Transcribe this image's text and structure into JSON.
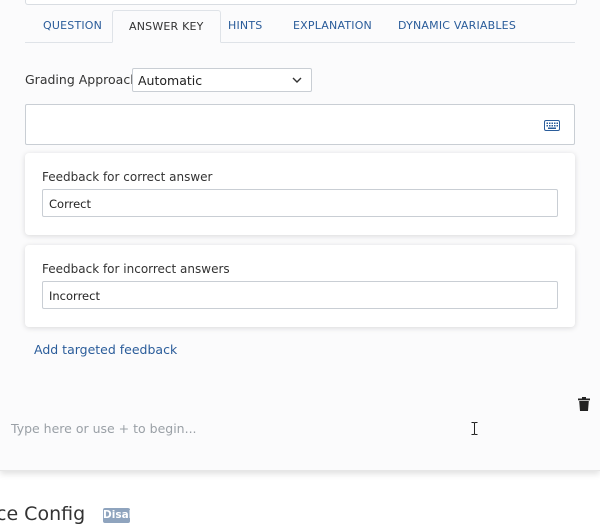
{
  "tabs": [
    {
      "label": "QUESTION"
    },
    {
      "label": "ANSWER KEY",
      "active": true
    },
    {
      "label": "HINTS"
    },
    {
      "label": "EXPLANATION"
    },
    {
      "label": "DYNAMIC VARIABLES"
    }
  ],
  "grading": {
    "label": "Grading Approach",
    "selected": "Automatic"
  },
  "answer_input": {
    "icon": "keyboard-icon"
  },
  "feedback_correct": {
    "label": "Feedback for correct answer",
    "value": "Correct"
  },
  "feedback_incorrect": {
    "label": "Feedback for incorrect answers",
    "value": "Incorrect"
  },
  "add_targeted_feedback": "Add targeted feedback",
  "editor": {
    "placeholder": "Type here or use + to begin...",
    "delete_icon": "trash-icon"
  },
  "section": {
    "title": "ce Config",
    "badge": "Disabled"
  },
  "colors": {
    "accent": "#2a5c9a",
    "badge_bg": "#8fa4be"
  }
}
